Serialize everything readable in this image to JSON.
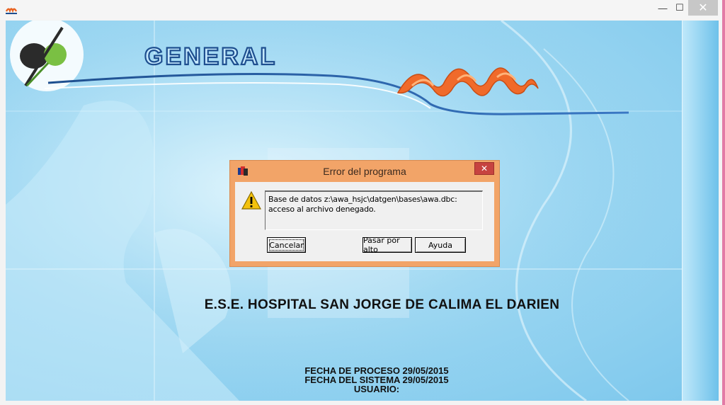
{
  "window": {
    "title_icon": "awa-app-icon",
    "controls": {
      "minimize": "—",
      "maximize": "☐",
      "close": "✕"
    }
  },
  "banner": {
    "logo_text": "GENERAL",
    "brand_icon": "awa-flame-logo"
  },
  "dialog": {
    "title": "Error del programa",
    "close_label": "✕",
    "icon": "warning-icon",
    "message": "Base de datos z:\\awa_hsjc\\datgen\\bases\\awa.dbc: acceso al archivo denegado.",
    "buttons": {
      "cancel": "Cancelar",
      "ignore": "Pasar por alto",
      "help": "Ayuda"
    }
  },
  "footer": {
    "hospital_name": "E.S.E. HOSPITAL SAN JORGE DE CALIMA EL DARIEN",
    "process_date": "FECHA DE PROCESO 29/05/2015",
    "system_date": "FECHA DEL SISTEMA 29/05/2015",
    "user": "USUARIO:"
  },
  "colors": {
    "accent_dialog": "#f2a468",
    "close_red": "#c74340",
    "background_blue": "#9fd8f2",
    "logo_blue": "#1e4f8f",
    "flame_orange": "#f06a2a"
  }
}
